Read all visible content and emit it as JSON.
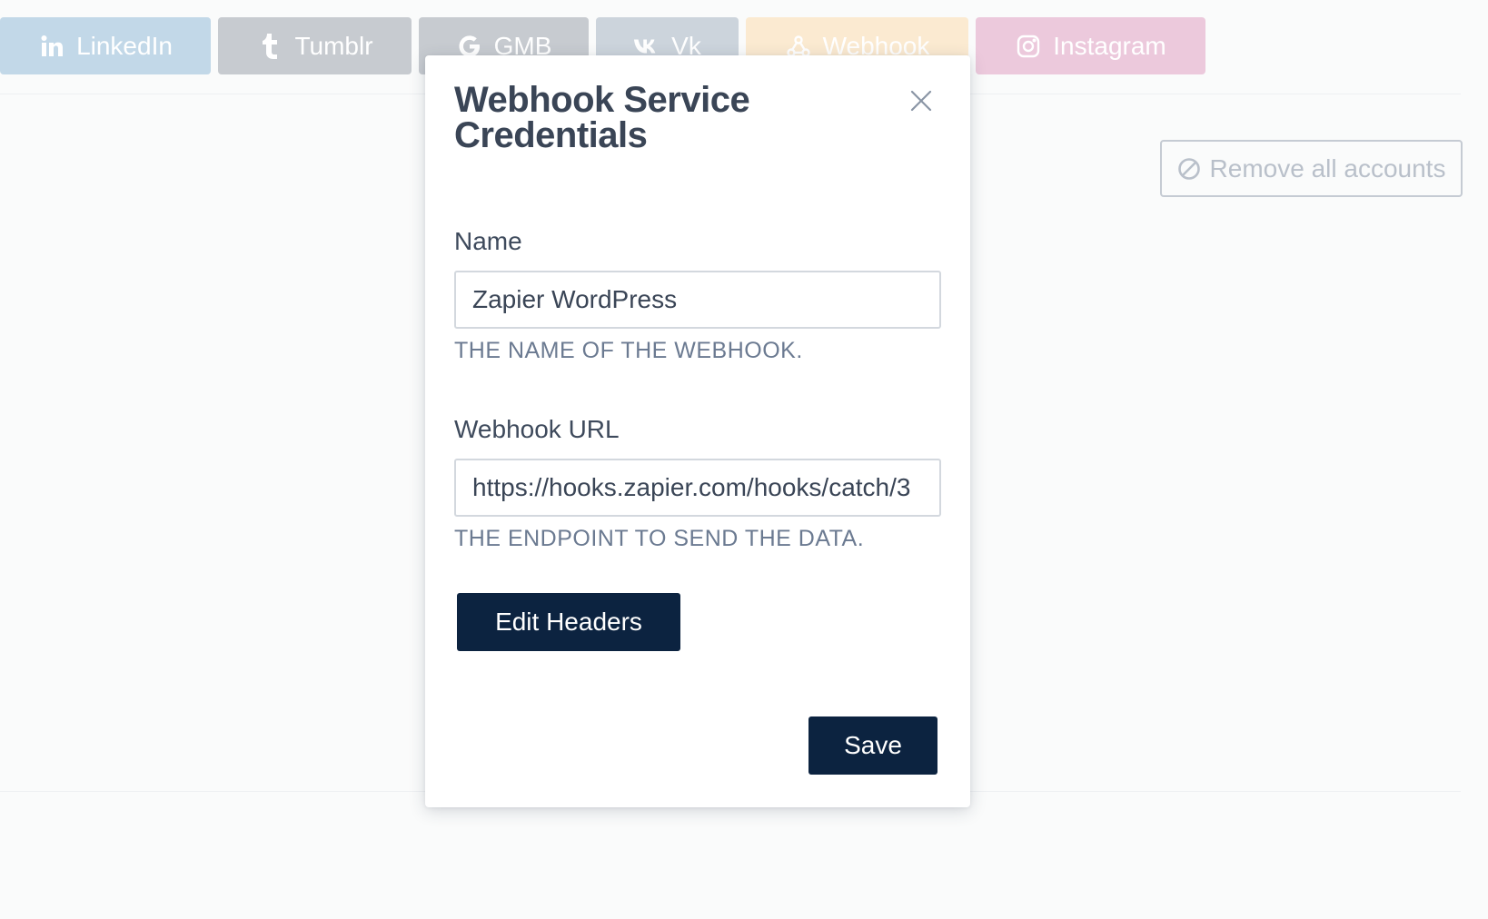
{
  "services": [
    {
      "label": "LinkedIn",
      "icon": "linkedin-icon"
    },
    {
      "label": "Tumblr",
      "icon": "tumblr-icon"
    },
    {
      "label": "GMB",
      "icon": "google-icon"
    },
    {
      "label": "Vk",
      "icon": "vk-icon"
    },
    {
      "label": "Webhook",
      "icon": "webhook-icon"
    },
    {
      "label": "Instagram",
      "icon": "instagram-icon"
    }
  ],
  "remove_all": {
    "label": "Remove all accounts",
    "icon": "ban-icon"
  },
  "modal": {
    "title": "Webhook Service Credentials",
    "close_icon": "close-icon",
    "name": {
      "label": "Name",
      "value": "Zapier WordPress",
      "help": "THE NAME OF THE WEBHOOK."
    },
    "url": {
      "label": "Webhook URL",
      "value": "https://hooks.zapier.com/hooks/catch/3",
      "help": "THE ENDPOINT TO SEND THE DATA."
    },
    "edit_headers_label": "Edit Headers",
    "save_label": "Save"
  },
  "colors": {
    "primary_button": "#0c2340",
    "linkedin": "#c2d8e8",
    "tumblr": "#c7cbd0",
    "gmb": "#c7cbd0",
    "vk": "#ccd4dc",
    "webhook": "#fbead1",
    "instagram": "#ecc9dc"
  }
}
